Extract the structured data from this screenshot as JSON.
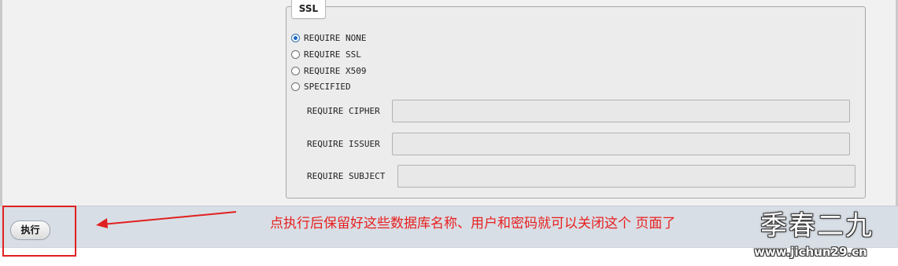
{
  "ssl_section": {
    "legend": "SSL",
    "options": [
      {
        "label": "REQUIRE NONE",
        "selected": true
      },
      {
        "label": "REQUIRE SSL",
        "selected": false
      },
      {
        "label": "REQUIRE X509",
        "selected": false
      },
      {
        "label": "SPECIFIED",
        "selected": false
      }
    ],
    "fields": [
      {
        "label": "REQUIRE CIPHER",
        "value": ""
      },
      {
        "label": "REQUIRE ISSUER",
        "value": ""
      },
      {
        "label": "REQUIRE SUBJECT",
        "value": ""
      }
    ]
  },
  "footer": {
    "execute_label": "执行"
  },
  "annotation": {
    "text": "点执行后保留好这些数据库名称、用户和密码就可以关闭这个 页面了",
    "color": "#e81f1f"
  },
  "watermark": {
    "title": "季春二九",
    "url": "www.jichun29.cn"
  }
}
